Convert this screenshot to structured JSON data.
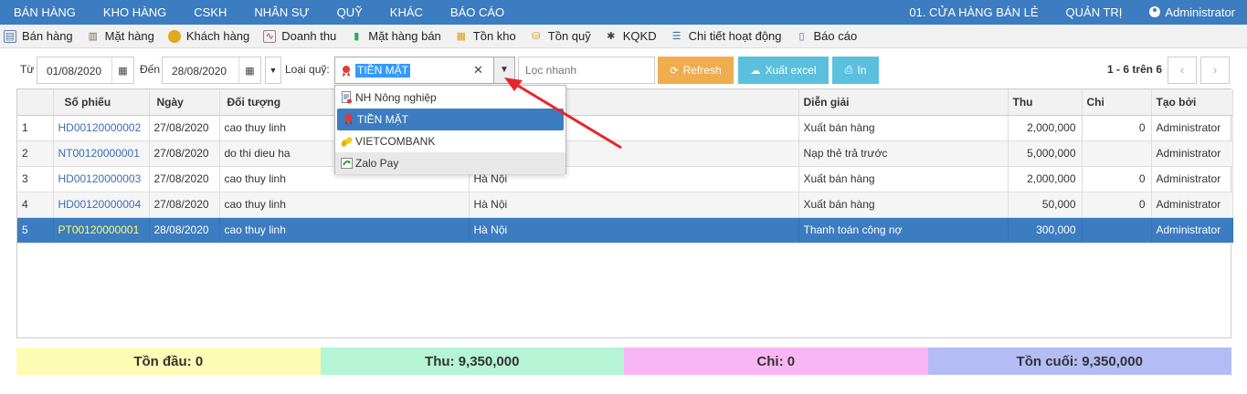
{
  "topnav": {
    "left": [
      "BÁN HÀNG",
      "KHO HÀNG",
      "CSKH",
      "NHÂN SỰ",
      "QUỸ",
      "KHÁC",
      "BÁO CÁO"
    ],
    "store": "01. CỬA HÀNG BÁN LẺ",
    "admin": "QUẢN TRỊ",
    "user": "Administrator"
  },
  "toolbar": [
    {
      "label": "Bán hàng",
      "icon": "cart-icon",
      "color": "#5a7fb5"
    },
    {
      "label": "Mặt hàng",
      "icon": "box-icon",
      "color": "#7a6a4f"
    },
    {
      "label": "Khách hàng",
      "icon": "customer-icon",
      "color": "#e0a820"
    },
    {
      "label": "Doanh thu",
      "icon": "revenue-icon",
      "color": "#c0392b"
    },
    {
      "label": "Mặt hàng bán",
      "icon": "bar-chart-icon",
      "color": "#27ae60"
    },
    {
      "label": "Tồn kho",
      "icon": "stock-icon",
      "color": "#d4a017"
    },
    {
      "label": "Tồn quỹ",
      "icon": "fund-icon",
      "color": "#d4a017"
    },
    {
      "label": "KQKD",
      "icon": "result-icon",
      "color": "#444444"
    },
    {
      "label": "Chi tiết hoạt động",
      "icon": "activity-icon",
      "color": "#3a6fb0"
    },
    {
      "label": "Báo cáo",
      "icon": "report-icon",
      "color": "#3a6fb0"
    }
  ],
  "filter": {
    "from_label": "Từ",
    "from_value": "01/08/2020",
    "to_label": "Đến",
    "to_value": "28/08/2020",
    "fund_label": "Loại quỹ:",
    "fund_value": "TIỀN MẶT",
    "quick_placeholder": "Lọc nhanh",
    "refresh": "Refresh",
    "excel": "Xuất excel",
    "print": "In",
    "page_info": "1 - 6 trên 6"
  },
  "fund_options": [
    {
      "label": "NH Nông nghiệp",
      "state": "normal"
    },
    {
      "label": "TIỀN MẶT",
      "state": "active"
    },
    {
      "label": "VIETCOMBANK",
      "state": "normal"
    },
    {
      "label": "Zalo Pay",
      "state": "hover"
    }
  ],
  "table": {
    "headers": [
      "",
      "Số phiếu",
      "Ngày",
      "Đối tượng",
      "",
      "Diễn giải",
      "Thu",
      "Chi",
      "Tạo bởi"
    ],
    "rows": [
      [
        "1",
        "HD00120000002",
        "27/08/2020",
        "cao thuy linh",
        "",
        "Xuất bán hàng",
        "2,000,000",
        "0",
        "Administrator"
      ],
      [
        "2",
        "NT00120000001",
        "27/08/2020",
        "do thi dieu ha",
        "",
        "Nạp thẻ trả trước",
        "5,000,000",
        "",
        "Administrator"
      ],
      [
        "3",
        "HD00120000003",
        "27/08/2020",
        "cao thuy linh",
        "Hà Nội",
        "Xuất bán hàng",
        "2,000,000",
        "0",
        "Administrator"
      ],
      [
        "4",
        "HD00120000004",
        "27/08/2020",
        "cao thuy linh",
        "Hà Nội",
        "Xuất bán hàng",
        "50,000",
        "0",
        "Administrator"
      ],
      [
        "5",
        "PT00120000001",
        "28/08/2020",
        "cao thuy linh",
        "Hà Nội",
        "Thanh toán công nợ",
        "300,000",
        "",
        "Administrator"
      ]
    ],
    "selected_row": 4
  },
  "summary": [
    {
      "text": "Tồn đầu: 0",
      "color": "#fdfcb4"
    },
    {
      "text": "Thu: 9,350,000",
      "color": "#b5f5d5"
    },
    {
      "text": "Chi: 0",
      "color": "#f9b6f4"
    },
    {
      "text": "Tồn cuối: 9,350,000",
      "color": "#b4bcf6"
    }
  ],
  "colors": {
    "nav": "#3c7cc0",
    "selected_row": "#3c7cc0",
    "arrow": "#e8262a"
  }
}
